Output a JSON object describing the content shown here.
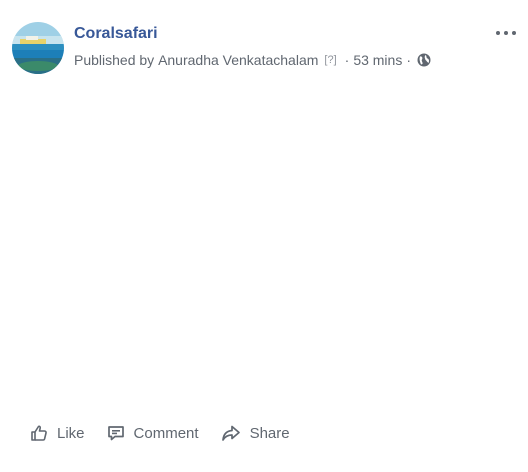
{
  "post": {
    "page_name": "Coralsafari",
    "published_by_prefix": "Published by",
    "publisher": "Anuradha Venkatachalam",
    "help_marker": "[?]",
    "separator": "·",
    "time": "53 mins",
    "privacy_icon": "globe-icon",
    "more_icon": "more-options-icon"
  },
  "actions": {
    "like_label": "Like",
    "comment_label": "Comment",
    "share_label": "Share"
  },
  "colors": {
    "page_name": "#385898",
    "meta_text": "#606770"
  }
}
